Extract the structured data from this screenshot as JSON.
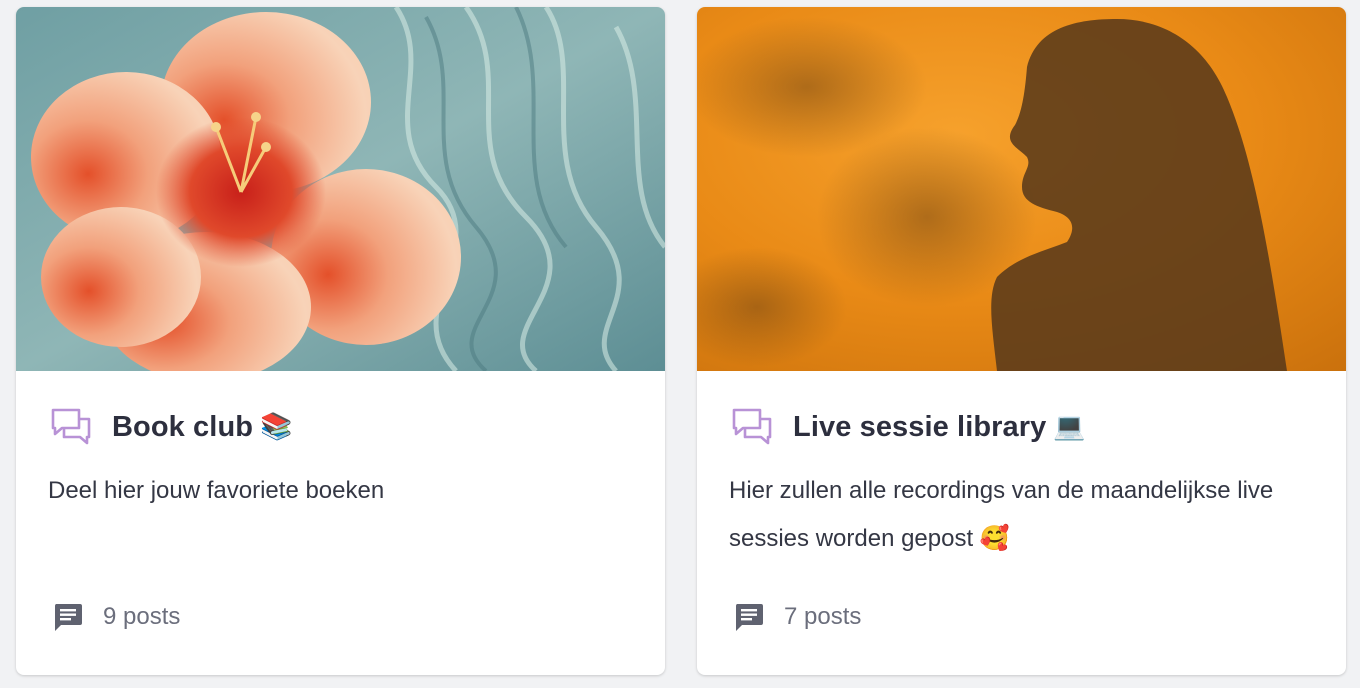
{
  "cards": [
    {
      "title": "Book club",
      "emoji": "📚",
      "description": "Deel hier jouw favoriete boeken",
      "posts": "9 posts",
      "cover": "hibiscus-flower-on-water"
    },
    {
      "title": "Live sessie library",
      "emoji": "💻",
      "description": "Hier zullen alle recordings van de maandelijkse live sessies worden gepost 🥰",
      "posts": "7 posts",
      "cover": "shadow-silhouette-on-orange-wall"
    }
  ],
  "colors": {
    "page_bg": "#f1f2f4",
    "card_bg": "#ffffff",
    "title": "#2d2f3e",
    "body_text": "#343744",
    "muted": "#6b6e7c",
    "chat_icon": "#b892d6",
    "message_icon": "#5f6270"
  },
  "icons": {
    "discussion": "chat-bubbles-icon",
    "posts": "message-icon"
  }
}
